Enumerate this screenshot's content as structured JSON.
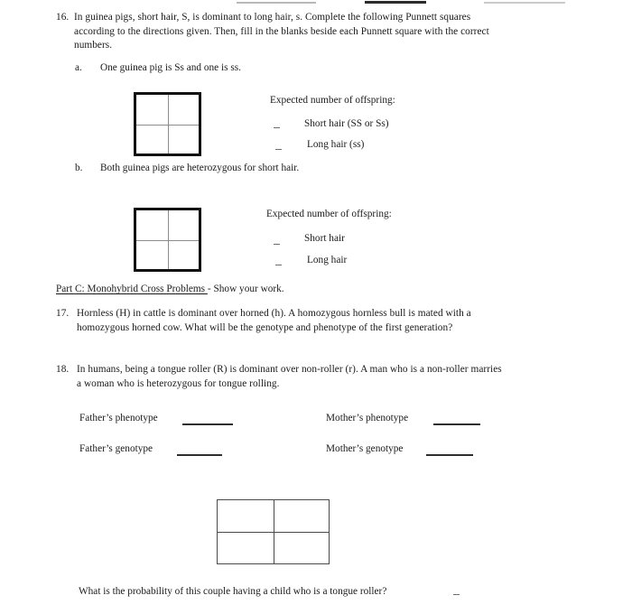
{
  "document": {
    "type": "genetics-worksheet",
    "top_partial_blanks": [
      "",
      "",
      ""
    ]
  },
  "q16": {
    "number": "16.",
    "line1": "In guinea pigs, short hair, S, is dominant to long hair, s.  Complete the following Punnett squares",
    "line2": "according to the directions given.  Then, fill in the blanks beside each Punnett square with the  correct",
    "line3": "numbers.",
    "part_a": {
      "letter": "a.",
      "text": "One guinea pig is Ss  and one is ss.",
      "expected_heading": "Expected number of offspring:",
      "rows": [
        {
          "blank": "",
          "label": "Short hair  (SS or Ss)"
        },
        {
          "blank": "",
          "label": "Long hair  (ss)"
        }
      ],
      "punnett": {
        "rows": 2,
        "cols": 2,
        "cells": [
          "",
          "",
          "",
          ""
        ]
      }
    },
    "part_b": {
      "letter": "b.",
      "text": "Both guinea pigs are heterozygous  for short hair.",
      "expected_heading": "Expected number of offspring:",
      "rows": [
        {
          "blank": "",
          "label": "Short hair"
        },
        {
          "blank": "",
          "label": "Long hair"
        }
      ],
      "punnett": {
        "rows": 2,
        "cols": 2,
        "cells": [
          "",
          "",
          "",
          ""
        ]
      }
    }
  },
  "part_c": {
    "title": "Part C:  Monohybrid Cross Problems ",
    "suffix": "-  Show your work."
  },
  "q17": {
    "number": "17.",
    "line1": "Hornless (H) in cattle is dominant over horned (h).  A homozygous hornless bull is mated with  a",
    "line2": "homozygous horned cow.  What will be the genotype and phenotype of the first generation?"
  },
  "q18": {
    "number": "18.",
    "line1": "In humans, being a tongue roller (R) is dominant over non-roller (r).  A man who is a non-roller  marries",
    "line2": "a woman who is heterozygous for tongue rolling.",
    "fields": {
      "father_phenotype": {
        "label": "Father’s phenotype",
        "value": ""
      },
      "mother_phenotype": {
        "label": "Mother’s phenotype",
        "value": ""
      },
      "father_genotype": {
        "label": "Father’s genotype",
        "value": ""
      },
      "mother_genotype": {
        "label": "Mother’s genotype",
        "value": ""
      }
    },
    "punnett": {
      "rows": 2,
      "cols": 2,
      "cells": [
        "",
        "",
        "",
        ""
      ]
    },
    "final_question": "What is the probability of this couple having a child who is a tongue roller?",
    "final_blank": ""
  }
}
